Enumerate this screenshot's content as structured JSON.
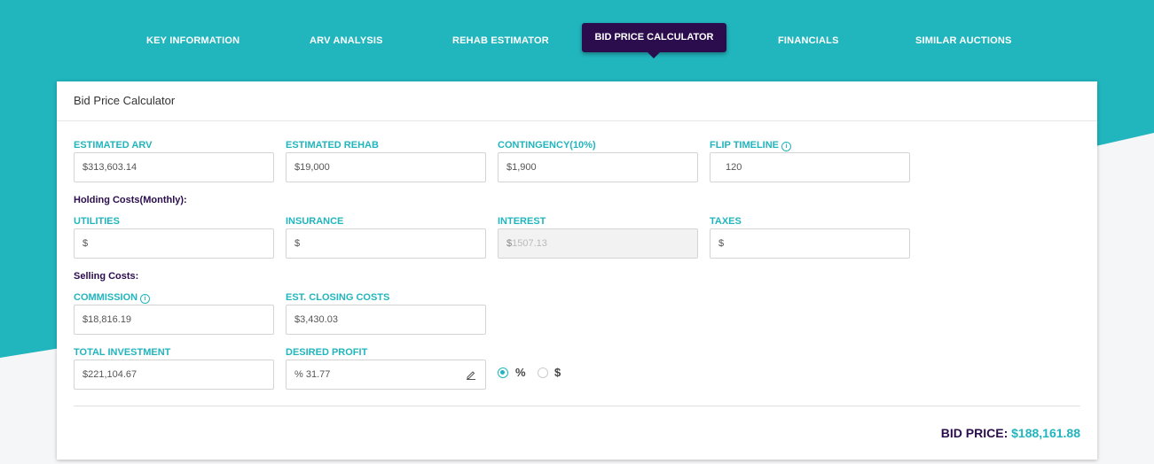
{
  "colors": {
    "teal": "#21b5bd",
    "purple": "#2b0d4e"
  },
  "nav": {
    "items": [
      {
        "label": "KEY INFORMATION"
      },
      {
        "label": "ARV ANALYSIS"
      },
      {
        "label": "REHAB ESTIMATOR"
      },
      {
        "label": "BID PRICE CALCULATOR"
      },
      {
        "label": "FINANCIALS"
      },
      {
        "label": "SIMILAR AUCTIONS"
      }
    ],
    "active_index": 3
  },
  "card": {
    "title": "Bid Price Calculator",
    "fields": {
      "estimated_arv": {
        "label": "ESTIMATED ARV",
        "value": "$313,603.14"
      },
      "estimated_rehab": {
        "label": "ESTIMATED REHAB",
        "value": "$19,000"
      },
      "contingency": {
        "label": "CONTINGENCY(10%)",
        "value": "$1,900"
      },
      "flip_timeline": {
        "label": "FLIP TIMELINE",
        "value": "120"
      },
      "utilities": {
        "label": "UTILITIES",
        "value": "$"
      },
      "insurance": {
        "label": "INSURANCE",
        "value": "$"
      },
      "interest": {
        "label": "INTEREST",
        "prefix": "$",
        "value": "1507.13"
      },
      "taxes": {
        "label": "TAXES",
        "value": "$"
      },
      "commission": {
        "label": "COMMISSION",
        "value": "$18,816.19"
      },
      "closing_costs": {
        "label": "EST. CLOSING COSTS",
        "value": "$3,430.03"
      },
      "total_investment": {
        "label": "TOTAL INVESTMENT",
        "value": "$221,104.67"
      },
      "desired_profit": {
        "label": "DESIRED PROFIT",
        "value": "% 31.77"
      }
    },
    "holding_costs_title": "Holding Costs(Monthly):",
    "selling_costs_title": "Selling Costs:",
    "profit_mode": {
      "options": [
        {
          "label": "%",
          "checked": true
        },
        {
          "label": "$",
          "checked": false
        }
      ]
    },
    "bid_price": {
      "label": "BID PRICE:",
      "value": "$188,161.88"
    }
  }
}
